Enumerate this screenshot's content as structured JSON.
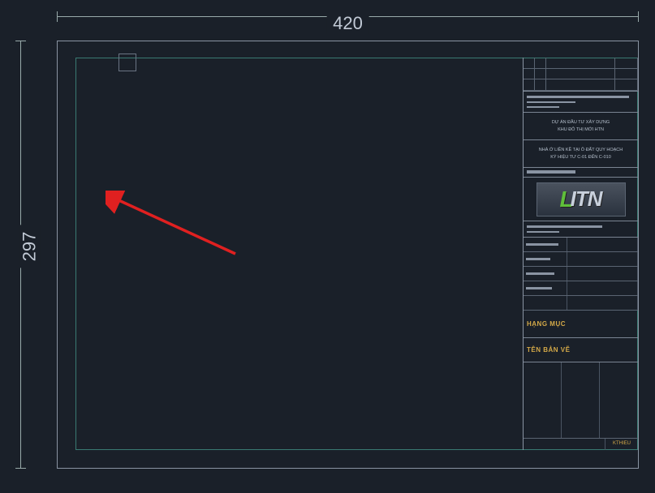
{
  "dimensions": {
    "width_label": "420",
    "height_label": "297"
  },
  "titleblock": {
    "project_line1": "DỰ ÁN ĐẦU TƯ XÂY DỰNG",
    "project_line2": "KHU ĐÔ THỊ MỚI HTN",
    "sub_line1": "NHÀ Ở LIỀN KỀ TẠI Ô ĐẤT QUY HOẠCH",
    "sub_line2": "KÝ HIỆU TƯ C-01 ĐẾN C-010",
    "logo_prefix": "L",
    "logo_suffix": "ITN",
    "section_hangmuc": "HẠNG MỤC",
    "section_tenbanve": "TÊN BẢN VẼ",
    "footer_code": "KTHIEU"
  }
}
